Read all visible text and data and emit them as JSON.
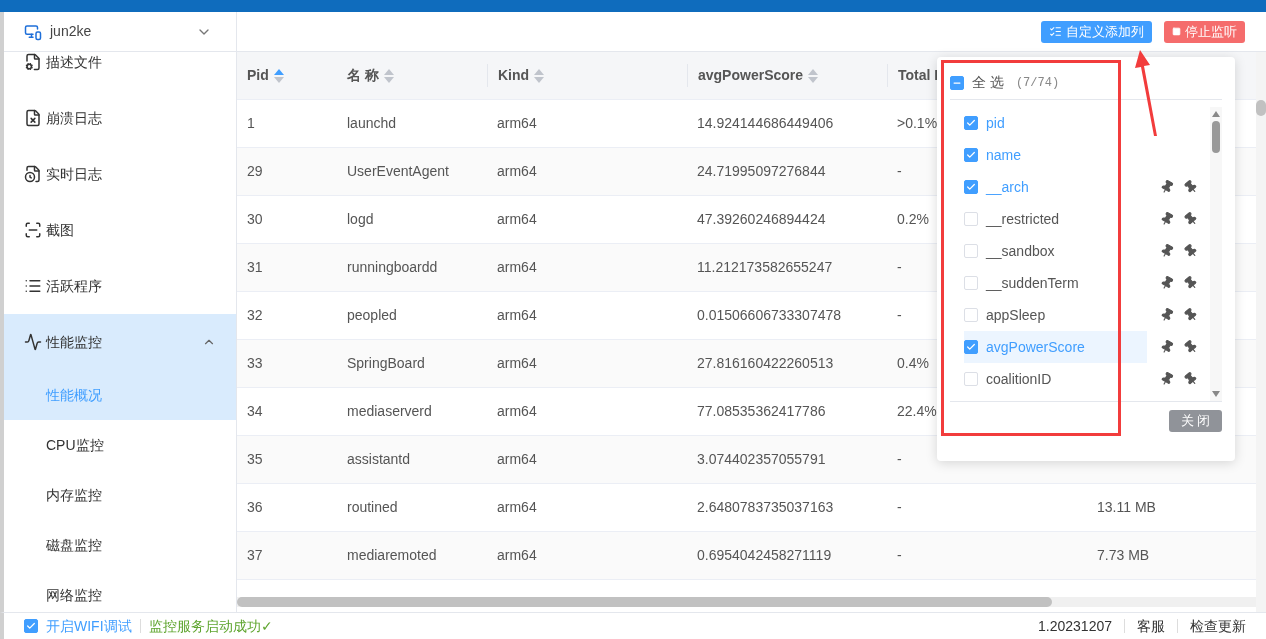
{
  "device": {
    "name": "jun2ke"
  },
  "sidebar": {
    "items": [
      {
        "label": "描述文件",
        "selected": false
      },
      {
        "label": "崩溃日志",
        "selected": false
      },
      {
        "label": "实时日志",
        "selected": false
      },
      {
        "label": "截图",
        "selected": false
      },
      {
        "label": "活跃程序",
        "selected": false
      },
      {
        "label": "性能监控",
        "selected": true,
        "expanded": true,
        "children": [
          {
            "label": "性能概况",
            "selected": true
          },
          {
            "label": "CPU监控",
            "selected": false
          },
          {
            "label": "内存监控",
            "selected": false
          },
          {
            "label": "磁盘监控",
            "selected": false
          },
          {
            "label": "网络监控",
            "selected": false
          }
        ]
      }
    ]
  },
  "toolbar": {
    "buttons": [
      {
        "label": "自定义添加列",
        "kind": "columns"
      },
      {
        "label": "停止监听",
        "kind": "stop"
      }
    ]
  },
  "table": {
    "columns": [
      {
        "label": "Pid",
        "sorted": true
      },
      {
        "label": "名 称",
        "sorted": false
      },
      {
        "label": "Kind",
        "sorted": false
      },
      {
        "label": "avgPowerScore",
        "sorted": false
      },
      {
        "label": "Total I"
      }
    ],
    "rows": [
      [
        "1",
        "launchd",
        "arm64",
        "14.924144686449406",
        ">0.1%"
      ],
      [
        "29",
        "UserEventAgent",
        "arm64",
        "24.71995097276844",
        "-"
      ],
      [
        "30",
        "logd",
        "arm64",
        "47.39260246894424",
        "0.2%"
      ],
      [
        "31",
        "runningboardd",
        "arm64",
        "11.212173582655247",
        "-"
      ],
      [
        "32",
        "peopled",
        "arm64",
        "0.01506606733307478",
        "-"
      ],
      [
        "33",
        "SpringBoard",
        "arm64",
        "27.816160422260513",
        "0.4%"
      ],
      [
        "34",
        "mediaserverd",
        "arm64",
        "77.08535362417786",
        "22.4%"
      ],
      [
        "35",
        "assistantd",
        "arm64",
        "3.074402357055791",
        "-"
      ],
      [
        "36",
        "routined",
        "arm64",
        "2.6480783735037163",
        "-",
        "13.11 MB"
      ],
      [
        "37",
        "mediaremoted",
        "arm64",
        "0.6954042458271119",
        "-",
        "7.73 MB"
      ]
    ]
  },
  "column_picker": {
    "select_all": {
      "label": "全 选",
      "count": "(7/74)",
      "indeterminate": true
    },
    "items": [
      {
        "label": "pid",
        "checked": true,
        "pinnable": false,
        "hovered": false
      },
      {
        "label": "name",
        "checked": true,
        "pinnable": false,
        "hovered": false
      },
      {
        "label": "__arch",
        "checked": true,
        "pinnable": true,
        "hovered": false
      },
      {
        "label": "__restricted",
        "checked": false,
        "pinnable": true,
        "hovered": false
      },
      {
        "label": "__sandbox",
        "checked": false,
        "pinnable": true,
        "hovered": false
      },
      {
        "label": "__suddenTerm",
        "checked": false,
        "pinnable": true,
        "hovered": false
      },
      {
        "label": "appSleep",
        "checked": false,
        "pinnable": true,
        "hovered": false
      },
      {
        "label": "avgPowerScore",
        "checked": true,
        "pinnable": true,
        "hovered": true
      },
      {
        "label": "coalitionID",
        "checked": false,
        "pinnable": true,
        "hovered": false
      }
    ],
    "close_button": "关 闭"
  },
  "status_bar": {
    "wifi_debug": {
      "label": "开启WIFI调试",
      "checked": true
    },
    "message": "监控服务启动成功✓",
    "version": "1.20231207",
    "links": [
      "客服",
      "检查更新"
    ]
  }
}
